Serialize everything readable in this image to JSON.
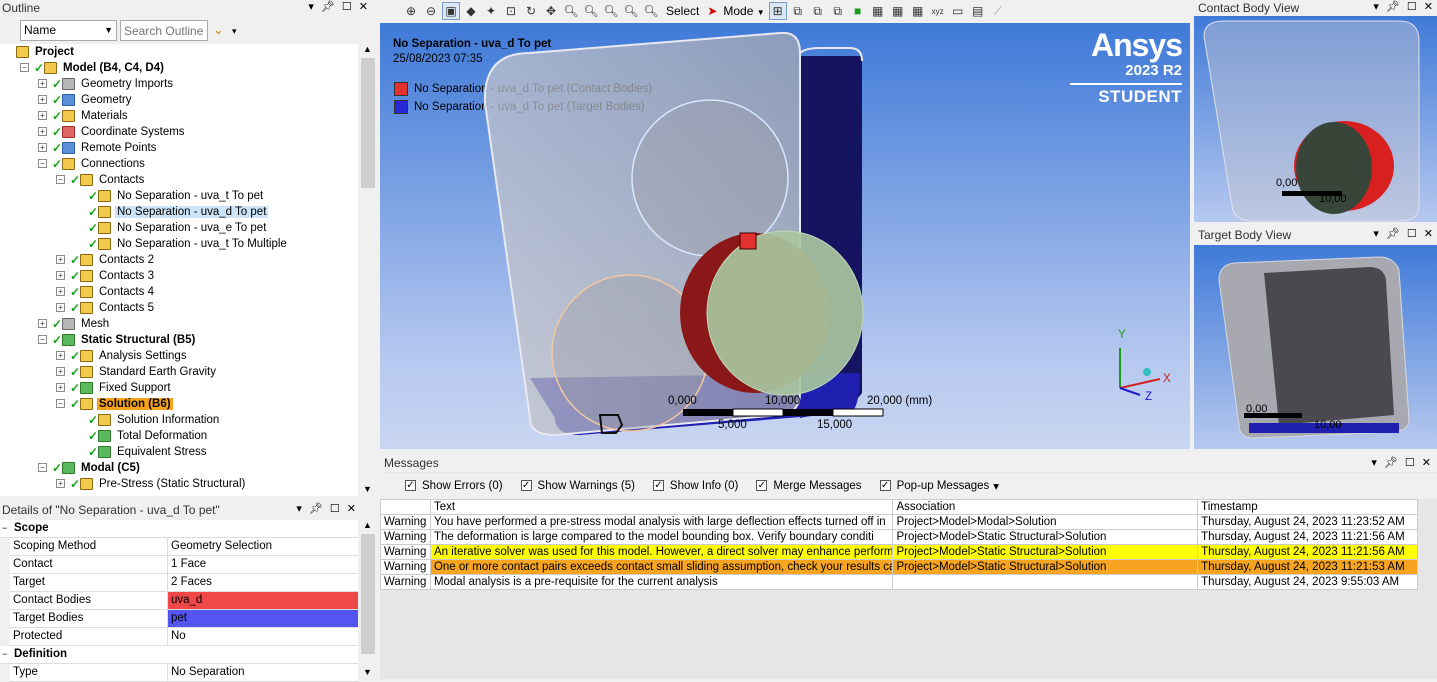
{
  "outline": {
    "title": "Outline",
    "name_field": "Name",
    "search_placeholder": "Search Outline",
    "tree": [
      {
        "label": "Project",
        "level": 0,
        "bold": true
      },
      {
        "label": "Model (B4, C4, D4)",
        "level": 1,
        "bold": true
      },
      {
        "label": "Geometry Imports",
        "level": 2
      },
      {
        "label": "Geometry",
        "level": 2
      },
      {
        "label": "Materials",
        "level": 2
      },
      {
        "label": "Coordinate Systems",
        "level": 2
      },
      {
        "label": "Remote Points",
        "level": 2
      },
      {
        "label": "Connections",
        "level": 2
      },
      {
        "label": "Contacts",
        "level": 3
      },
      {
        "label": "No Separation - uva_t To pet",
        "level": 4
      },
      {
        "label": "No Separation - uva_d To pet",
        "level": 4,
        "selected": true
      },
      {
        "label": "No Separation - uva_e To pet",
        "level": 4
      },
      {
        "label": "No Separation - uva_t To Multiple",
        "level": 4
      },
      {
        "label": "Contacts 2",
        "level": 3
      },
      {
        "label": "Contacts 3",
        "level": 3
      },
      {
        "label": "Contacts 4",
        "level": 3
      },
      {
        "label": "Contacts 5",
        "level": 3
      },
      {
        "label": "Mesh",
        "level": 2
      },
      {
        "label": "Static Structural (B5)",
        "level": 2,
        "bold": true
      },
      {
        "label": "Analysis Settings",
        "level": 3
      },
      {
        "label": "Standard Earth Gravity",
        "level": 3
      },
      {
        "label": "Fixed Support",
        "level": 3
      },
      {
        "label": "Solution (B6)",
        "level": 3,
        "bold": true,
        "highlight": true
      },
      {
        "label": "Solution Information",
        "level": 4
      },
      {
        "label": "Total Deformation",
        "level": 4
      },
      {
        "label": "Equivalent Stress",
        "level": 4
      },
      {
        "label": "Modal (C5)",
        "level": 2,
        "bold": true
      },
      {
        "label": "Pre-Stress (Static Structural)",
        "level": 3
      }
    ]
  },
  "details": {
    "title": "Details of \"No Separation - uva_d To pet\"",
    "scope_section": "Scope",
    "rows": [
      {
        "k": "Scoping Method",
        "v": "Geometry Selection"
      },
      {
        "k": "Contact",
        "v": "1 Face"
      },
      {
        "k": "Target",
        "v": "2 Faces"
      },
      {
        "k": "Contact Bodies",
        "v": "uva_d",
        "color": "#f04848"
      },
      {
        "k": "Target Bodies",
        "v": "pet",
        "color": "#5454f0"
      },
      {
        "k": "Protected",
        "v": "No"
      }
    ],
    "definition_section": "Definition",
    "def_rows": [
      {
        "k": "Type",
        "v": "No Separation"
      }
    ]
  },
  "toolbar": {
    "select_label": "Select",
    "mode_label": "Mode"
  },
  "viewport": {
    "title": "No Separation - uva_d To pet",
    "date": "25/08/2023 07:35",
    "legend": [
      {
        "label": "No Separation - uva_d To pet (Contact Bodies)",
        "color": "#e53030"
      },
      {
        "label": "No Separation - uva_d To pet (Target Bodies)",
        "color": "#2828d8"
      }
    ],
    "brand": "Ansys",
    "version": "2023 R2",
    "edition": "STUDENT",
    "scale": {
      "t0": "0,000",
      "t1": "10,000",
      "t2": "20,000 (mm)",
      "b1": "5,000",
      "b2": "15,000"
    },
    "axes": {
      "x": "X",
      "y": "Y",
      "z": "Z"
    }
  },
  "contact_view": {
    "title": "Contact Body View",
    "s0": "0,00",
    "s1": "10,00"
  },
  "target_view": {
    "title": "Target Body View",
    "s0": "0,00",
    "s1": "10,00"
  },
  "messages": {
    "title": "Messages",
    "filters": [
      {
        "label": "Show Errors",
        "count": "(0)"
      },
      {
        "label": "Show Warnings",
        "count": "(5)"
      },
      {
        "label": "Show Info",
        "count": "(0)"
      },
      {
        "label": "Merge Messages",
        "count": ""
      },
      {
        "label": "Pop-up Messages",
        "count": ""
      }
    ],
    "headers": [
      "",
      "Text",
      "Association",
      "Timestamp"
    ],
    "rows": [
      {
        "type": "Warning",
        "text": "You have performed a pre-stress modal analysis with large deflection effects turned off in",
        "assoc": "Project>Model>Modal>Solution",
        "time": "Thursday, August 24, 2023 11:23:52 AM",
        "style": ""
      },
      {
        "type": "Warning",
        "text": "The deformation is large compared to the model bounding box.  Verify boundary conditi",
        "assoc": "Project>Model>Static Structural>Solution",
        "time": "Thursday, August 24, 2023 11:21:56 AM",
        "style": ""
      },
      {
        "type": "Warning",
        "text": "An iterative solver was used for this model.  However, a direct solver may enhance perform",
        "assoc": "Project>Model>Static Structural>Solution",
        "time": "Thursday, August 24, 2023 11:21:56 AM",
        "style": "yel"
      },
      {
        "type": "Warning",
        "text": "One or more contact pairs exceeds contact small sliding assumption, check your results ca",
        "assoc": "Project>Model>Static Structural>Solution",
        "time": "Thursday, August 24, 2023 11:21:53 AM",
        "style": "org"
      },
      {
        "type": "Warning",
        "text": "Modal analysis is a pre-requisite for the current analysis",
        "assoc": "",
        "time": "Thursday, August 24, 2023 9:55:03 AM",
        "style": ""
      }
    ]
  }
}
